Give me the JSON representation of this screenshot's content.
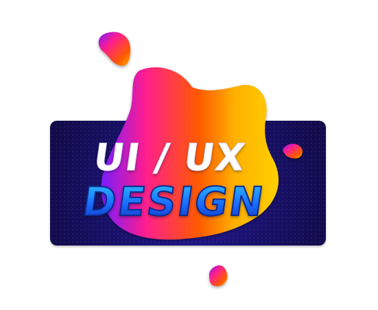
{
  "banner": {
    "line1": "UI / UX",
    "line2": "DESIGN"
  },
  "colors": {
    "panel_dark": "#100a45",
    "panel_mid": "#2a1aa8",
    "blob_magenta": "#ff1f8e",
    "blob_orange": "#ffb000",
    "blob_purple": "#7a1cff",
    "design_cyan": "#2fc7ff",
    "design_blue": "#1a6cff"
  },
  "icons": [
    "blob-shape-icon",
    "small-blob-icon"
  ]
}
